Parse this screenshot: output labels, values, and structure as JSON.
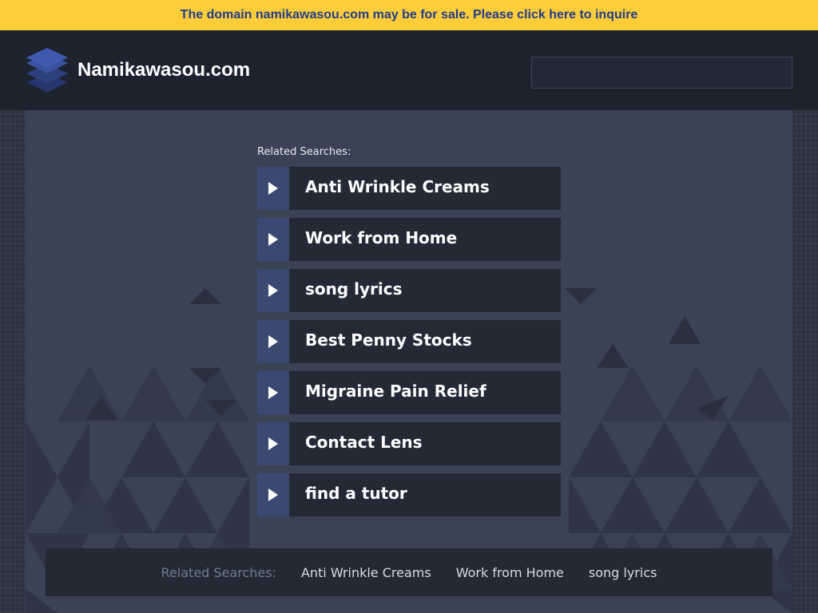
{
  "banner": {
    "text": "The domain namikawasou.com may be for sale. Please click here to inquire",
    "bg_color": "#ffcc3a",
    "text_color": "#1f3d8a"
  },
  "header": {
    "logo_icon": "stacked-layers-icon",
    "site_name": "Namikawasou.com",
    "search_value": ""
  },
  "main": {
    "related_label": "Related Searches:",
    "links": [
      "Anti Wrinkle Creams",
      "Work from Home",
      "song lyrics",
      "Best Penny Stocks",
      "Migraine Pain Relief",
      "Contact Lens",
      "find a tutor"
    ],
    "arrow_icon": "play-triangle-icon",
    "accent_color": "#3b4972"
  },
  "footer": {
    "label": "Related Searches:",
    "links": [
      "Anti Wrinkle Creams",
      "Work from Home",
      "song lyrics"
    ]
  }
}
